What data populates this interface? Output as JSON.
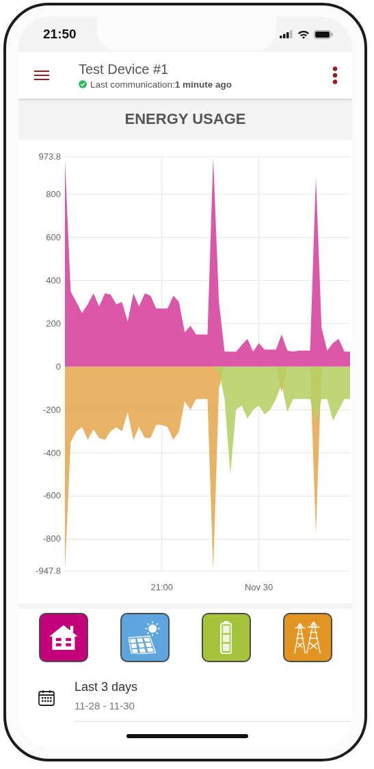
{
  "status_bar": {
    "time": "21:50"
  },
  "app_bar": {
    "title": "Test Device #1",
    "online": true,
    "status": "Last communication:**1 minute ago**"
  },
  "section_title": "ENERGY USAGE",
  "chart_data": {
    "type": "area",
    "categories": [
      null,
      null,
      null,
      null,
      null,
      null,
      null,
      null,
      null,
      null,
      null,
      null,
      null,
      null,
      null,
      null,
      null,
      "21:00",
      null,
      null,
      null,
      null,
      null,
      null,
      null,
      null,
      null,
      null,
      null,
      null,
      null,
      null,
      null,
      null,
      "Nov 30",
      null,
      null,
      null,
      null,
      null,
      null,
      null,
      null,
      null,
      null,
      null,
      null,
      null,
      null,
      null,
      null
    ],
    "grid": true,
    "ylim": [
      -947.8,
      973.8
    ],
    "yticks": [
      {
        "value": -947.8,
        "label": "-947.8"
      },
      -800,
      -600,
      -400,
      -200,
      0,
      200,
      400,
      600,
      800,
      {
        "value": 973.8,
        "label": "973.8"
      }
    ],
    "series": [
      {
        "color": "#d6409b",
        "values": [
          960,
          350,
          300,
          250,
          290,
          340,
          280,
          340,
          335,
          290,
          300,
          210,
          340,
          280,
          340,
          330,
          270,
          270,
          270,
          330,
          300,
          160,
          190,
          150,
          150,
          150,
          970,
          300,
          70,
          70,
          70,
          100,
          130,
          70,
          110,
          80,
          80,
          80,
          150,
          75,
          70,
          75,
          75,
          75,
          880,
          180,
          75,
          110,
          130,
          70,
          70
        ]
      },
      {
        "color": "#e5a94f",
        "values": [
          -947,
          -350,
          -300,
          -280,
          -340,
          -290,
          -330,
          -340,
          -300,
          -280,
          -300,
          -210,
          -340,
          -280,
          -330,
          -330,
          -270,
          -270,
          -280,
          -340,
          -300,
          -160,
          -200,
          -150,
          -150,
          -150,
          -947,
          -100,
          0,
          0,
          0,
          0,
          0,
          0,
          0,
          0,
          0,
          0,
          -120,
          0,
          0,
          0,
          0,
          0,
          -780,
          0,
          0,
          0,
          0,
          0,
          0
        ]
      },
      {
        "color": "#b5d064",
        "values": [
          0,
          0,
          0,
          0,
          0,
          0,
          0,
          0,
          0,
          0,
          0,
          0,
          0,
          0,
          0,
          0,
          0,
          0,
          0,
          0,
          0,
          0,
          0,
          0,
          0,
          0,
          0,
          -20,
          -150,
          -500,
          -200,
          -180,
          -240,
          -200,
          -180,
          -220,
          -200,
          -150,
          -80,
          -210,
          -150,
          -150,
          -150,
          -150,
          -260,
          -150,
          -150,
          -250,
          -200,
          -150,
          -150
        ]
      }
    ]
  },
  "sources": [
    {
      "kind": "house",
      "color": "#c4007a"
    },
    {
      "kind": "solar",
      "color": "#5ea5dd"
    },
    {
      "kind": "battery",
      "color": "#a5c43c"
    },
    {
      "kind": "grid",
      "color": "#e39524"
    }
  ],
  "date_range": {
    "label": "Last 3 days",
    "range": "11-28 - 11-30"
  }
}
